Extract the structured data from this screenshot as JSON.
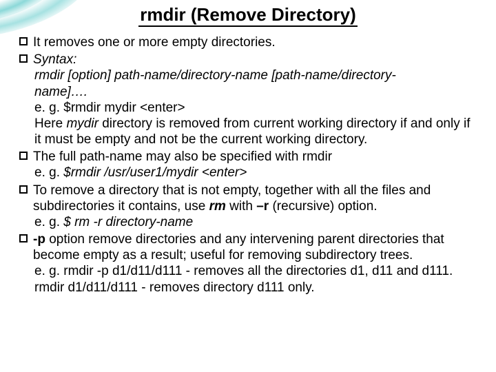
{
  "title_text": "rmdir (Remove Directory)",
  "b1": {
    "line": "It removes one or more empty directories."
  },
  "b2": {
    "syntax_label": "Syntax:",
    "syntax_line_a": "rmdir   [option]  path-name/directory-name [path-name/directory-",
    "syntax_line_b": "name]….",
    "eg_prefix": "e. g.      ",
    "eg_cmd": "$rmdir mydir <enter>",
    "desc_a": "Here ",
    "desc_mydir": "mydir",
    "desc_b": " directory is removed from current working directory if and only if it must be  empty and not be the current working directory."
  },
  "b3": {
    "line": "The full path-name may also be specified with rmdir",
    "eg_prefix": "e. g.      ",
    "eg_cmd": "$rmdir /usr/user1/mydir <enter>"
  },
  "b4": {
    "line_a": "To remove a directory that is not empty, together with all the files and subdirectories it contains, use ",
    "rm": "rm",
    "line_b": " with ",
    "flag": "–r",
    "line_c": " (recursive) option.",
    "eg_prefix": "e. g.      ",
    "eg_cmd": "$ rm  -r  directory-name"
  },
  "b5": {
    "flag": "-p",
    "line": " option remove directories and any intervening parent directories that become empty as a result; useful for removing subdirectory trees.",
    "eg1_a": "e. g.      rmdir   -p   d1/d11/d111 -  removes all the directories  d1, d11 and d111.",
    "eg2": "rmdir    d1/d11/d111  -  removes directory d111 only."
  }
}
